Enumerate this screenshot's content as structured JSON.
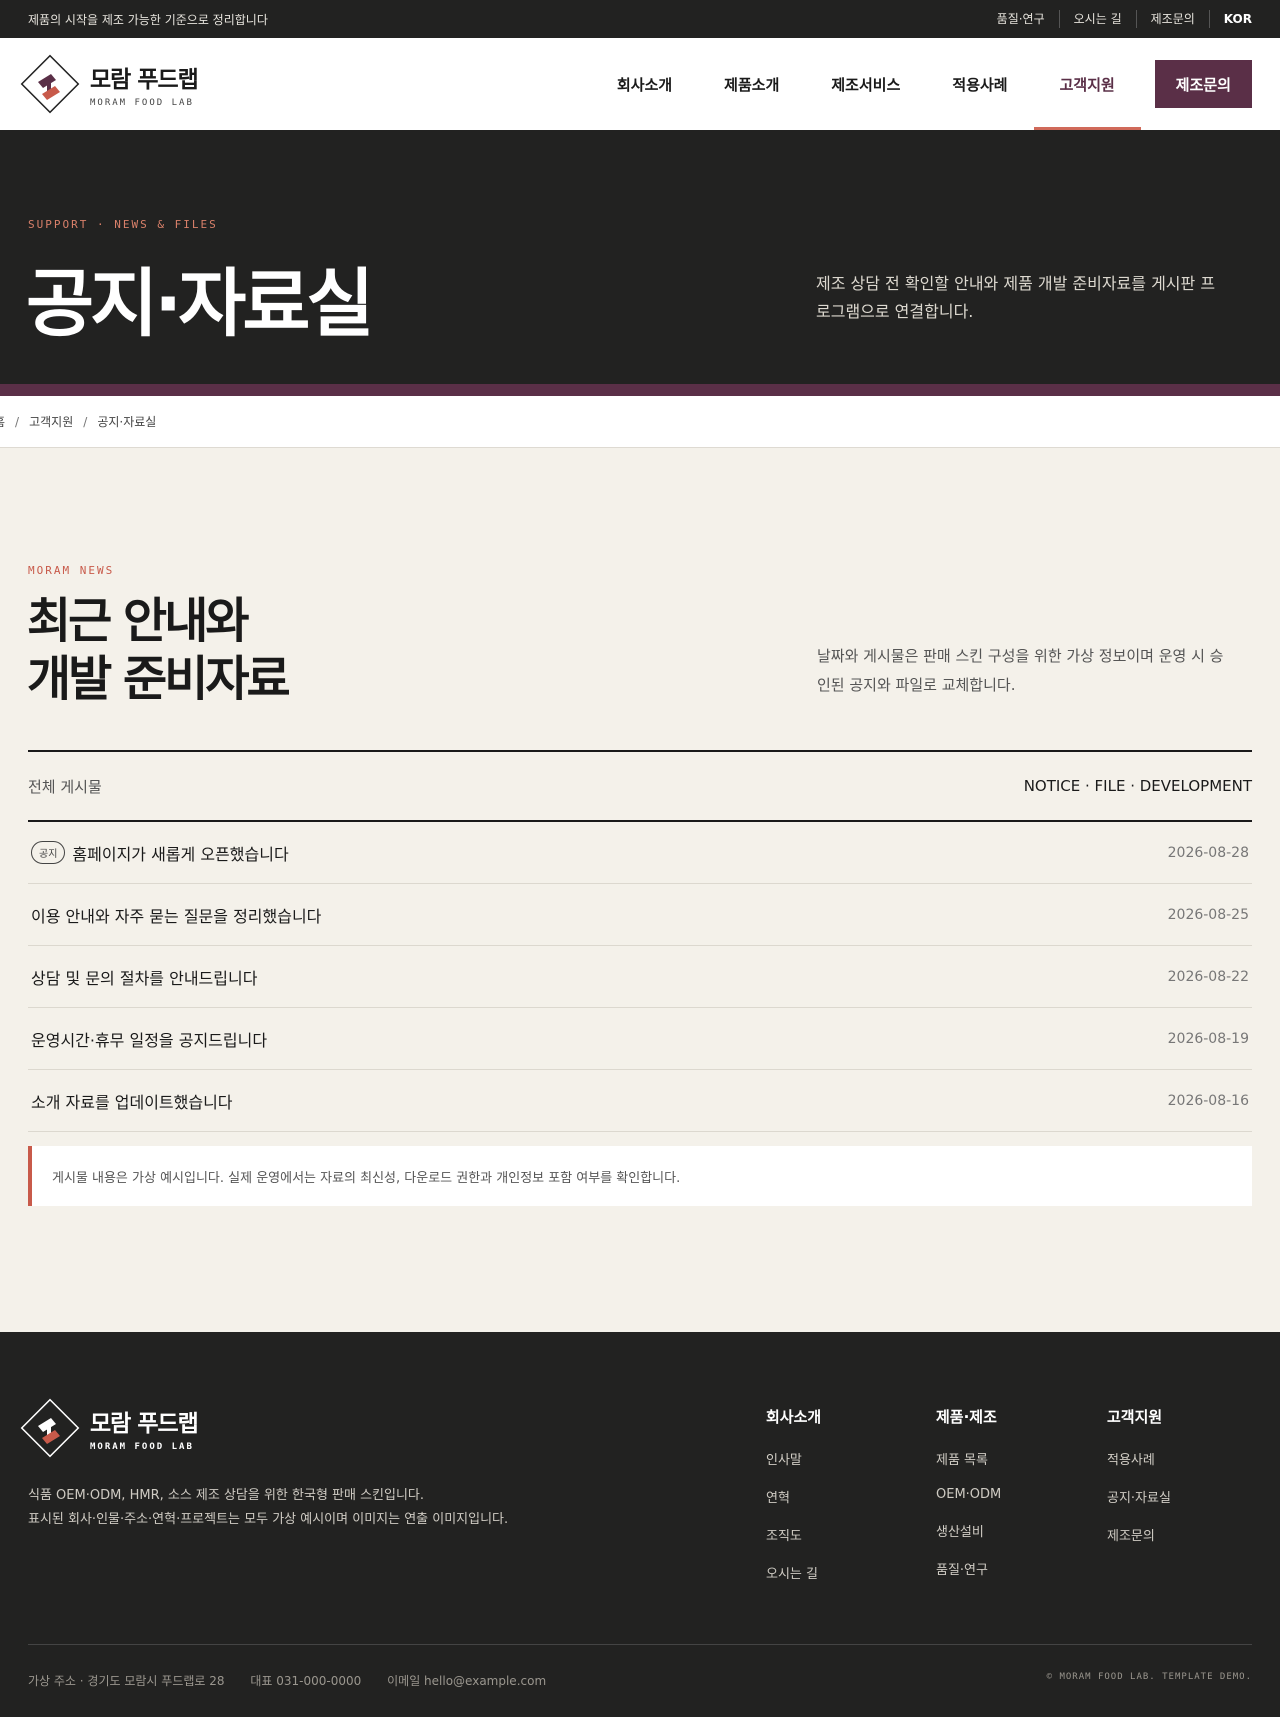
{
  "topbar": {
    "tagline": "제품의 시작을 제조 가능한 기준으로 정리합니다",
    "links": [
      "품질·연구",
      "오시는 길",
      "제조문의"
    ],
    "lang": "KOR"
  },
  "brand": {
    "name": "모람 푸드랩",
    "sub": "MORAM FOOD LAB"
  },
  "nav": {
    "items": [
      "회사소개",
      "제품소개",
      "제조서비스",
      "적용사례",
      "고객지원"
    ],
    "active": "고객지원",
    "cta": "제조문의"
  },
  "hero": {
    "eyebrow": "SUPPORT · NEWS & FILES",
    "title": "공지·자료실",
    "desc": "제조 상담 전 확인할 안내와 제품 개발 준비자료를 게시판 프로그램으로 연결합니다."
  },
  "breadcrumb": [
    "홈",
    "고객지원",
    "공지·자료실"
  ],
  "section": {
    "eyebrow": "MORAM NEWS",
    "title_line1": "최근 안내와",
    "title_line2": "개발 준비자료",
    "intro": "날짜와 게시물은 판매 스킨 구성을 위한 가상 정보이며 운영 시 승인된 공지와 파일로 교체합니다."
  },
  "board": {
    "all_label": "전체 게시물",
    "categories": "NOTICE · FILE · DEVELOPMENT",
    "posts": [
      {
        "badge": "공지",
        "title": "홈페이지가 새롭게 오픈했습니다",
        "date": "2026-08-28"
      },
      {
        "badge": "",
        "title": "이용 안내와 자주 묻는 질문을 정리했습니다",
        "date": "2026-08-25"
      },
      {
        "badge": "",
        "title": "상담 및 문의 절차를 안내드립니다",
        "date": "2026-08-22"
      },
      {
        "badge": "",
        "title": "운영시간·휴무 일정을 공지드립니다",
        "date": "2026-08-19"
      },
      {
        "badge": "",
        "title": "소개 자료를 업데이트했습니다",
        "date": "2026-08-16"
      }
    ],
    "notice": "게시물 내용은 가상 예시입니다. 실제 운영에서는 자료의 최신성, 다운로드 권한과 개인정보 포함 여부를 확인합니다."
  },
  "footer": {
    "desc_line1": "식품 OEM·ODM, HMR, 소스 제조 상담을 위한 한국형 판매 스킨입니다.",
    "desc_line2": "표시된 회사·인물·주소·연혁·프로젝트는 모두 가상 예시이며 이미지는 연출 이미지입니다.",
    "columns": [
      {
        "title": "회사소개",
        "links": [
          "인사말",
          "연혁",
          "조직도",
          "오시는 길"
        ]
      },
      {
        "title": "제품·제조",
        "links": [
          "제품 목록",
          "OEM·ODM",
          "생산설비",
          "품질·연구"
        ]
      },
      {
        "title": "고객지원",
        "links": [
          "적용사례",
          "공지·자료실",
          "제조문의"
        ]
      }
    ],
    "address": "가상 주소 · 경기도 모람시 푸드랩로 28",
    "phone": "대표 031-000-0000",
    "email": "이메일 hello@example.com",
    "copyright": "© MORAM FOOD LAB. TEMPLATE DEMO."
  },
  "colors": {
    "dark": "#222221",
    "brand": "#5a2f47",
    "accent": "#c85a4a",
    "bg": "#f4f1ea"
  }
}
